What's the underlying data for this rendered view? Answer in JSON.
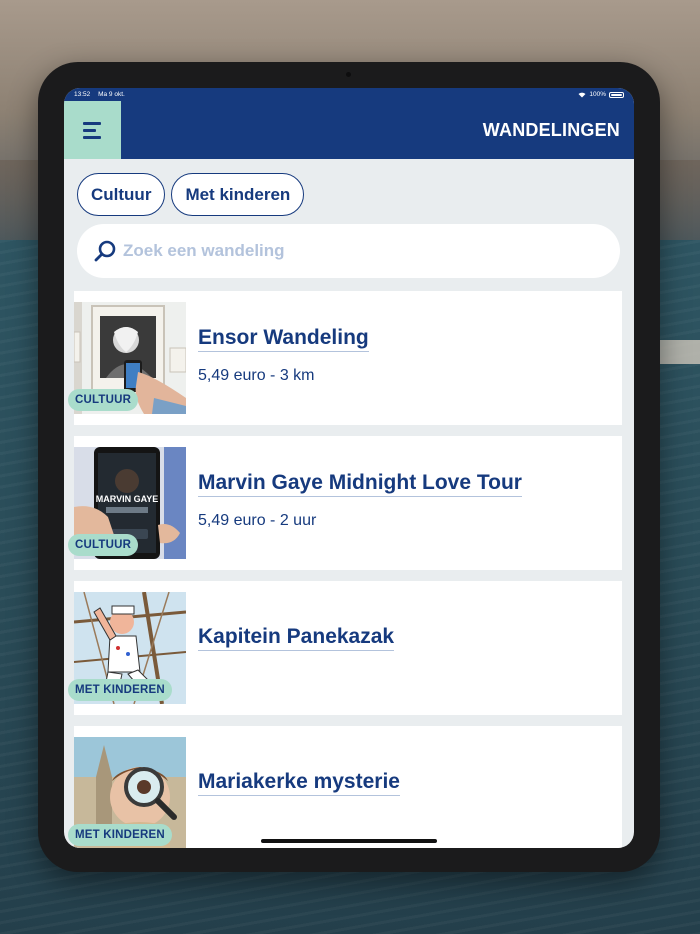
{
  "status_bar": {
    "time": "13:52",
    "date": "Ma 9 okt.",
    "battery": "100%"
  },
  "header": {
    "title": "WANDELINGEN",
    "menu_icon": "hamburger-menu-icon"
  },
  "filters": [
    {
      "label": "Cultuur"
    },
    {
      "label": "Met kinderen"
    }
  ],
  "search": {
    "placeholder": "Zoek een wandeling",
    "value": "",
    "icon": "search-icon"
  },
  "walks": [
    {
      "title": "Ensor Wandeling",
      "details": "5,49 euro - 3 km",
      "tag": "CULTUUR"
    },
    {
      "title": "Marvin Gaye Midnight Love Tour",
      "details": "5,49 euro - 2 uur",
      "tag": "CULTUUR",
      "image_text": "MARVIN GAYE"
    },
    {
      "title": "Kapitein Panekazak",
      "details": "",
      "tag": "MET KINDEREN"
    },
    {
      "title": "Mariakerke mysterie",
      "details": "",
      "tag": "MET KINDEREN"
    }
  ],
  "colors": {
    "primary": "#163a7e",
    "accent": "#a9dccb",
    "background": "#e9edef",
    "muted": "#b3c3dc"
  }
}
